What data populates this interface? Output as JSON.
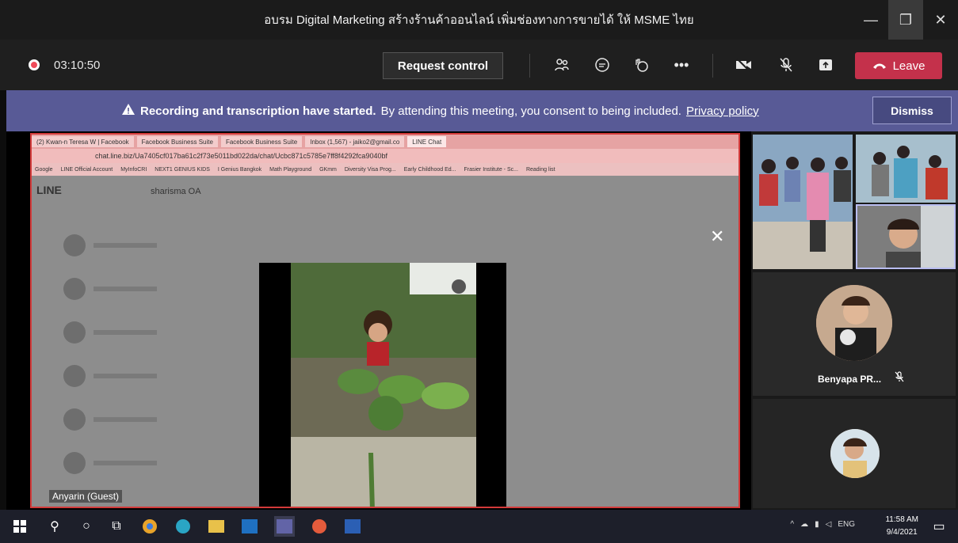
{
  "window": {
    "title": "อบรม Digital Marketing สร้างร้านค้าออนไลน์ เพิ่มช่องทางการขายได้ ให้ MSME ไทย"
  },
  "toolbar": {
    "timer": "03:10:50",
    "request_control": "Request control",
    "leave": "Leave"
  },
  "banner": {
    "bold": "Recording and transcription have started.",
    "text": "By attending this meeting, you consent to being included.",
    "link": "Privacy policy",
    "dismiss": "Dismiss"
  },
  "shared_screen": {
    "tabs": [
      "(2) Kwan-n Teresa W | Facebook",
      "Facebook Business Suite",
      "Facebook Business Suite",
      "Inbox (1,567) - jaiko2@gmail.co",
      "LINE Chat"
    ],
    "address": "chat.line.biz/Ua7405cf017ba61c2f73e5011bd022da/chat/Ucbc871c5785e7ff8f4292fca9040bf",
    "bookmarks": [
      "Google",
      "LINE Official Account",
      "MyInfoCRI",
      "NEXT1 GENIUS KIDS",
      "I Genius Bangkok",
      "Math Playground",
      "GKmm",
      "Diversity Visa Prog...",
      "Early Childhood Ed...",
      "Frasier Institute - Sc...",
      "Reading list"
    ],
    "line_brand": "LINE",
    "account": "sharisma OA",
    "presenter": "Anyarin (Guest)"
  },
  "participants": {
    "mid_name": "Benyapa PR..."
  },
  "taskbar": {
    "time": "11:58 AM",
    "date": "9/4/2021",
    "lang": "ENG"
  }
}
